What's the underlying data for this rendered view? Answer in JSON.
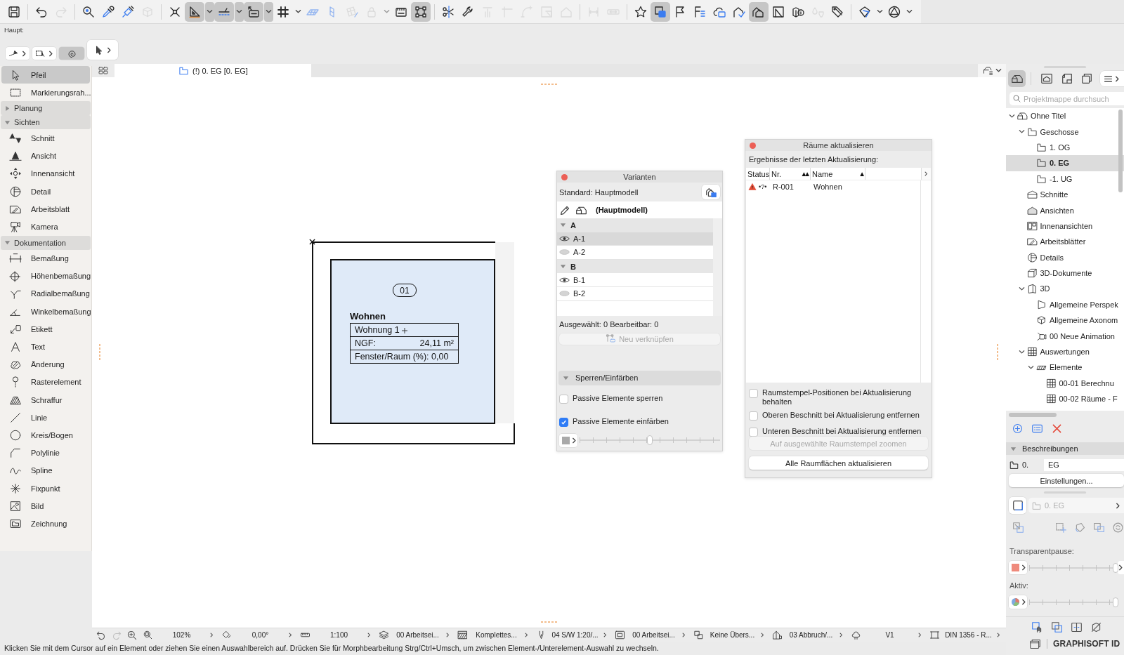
{
  "toolbar": {
    "groups": [
      {
        "buttons": [
          {
            "kind": "save",
            "pressed": false,
            "disabled": false,
            "has_menu": false
          }
        ]
      },
      {
        "buttons": [
          {
            "kind": "undo",
            "pressed": false,
            "disabled": false,
            "has_menu": false
          },
          {
            "kind": "redo",
            "pressed": false,
            "disabled": true,
            "has_menu": false
          }
        ]
      },
      {
        "buttons": [
          {
            "kind": "find",
            "pressed": false,
            "disabled": false,
            "has_menu": false
          },
          {
            "kind": "eyedropper",
            "pressed": false,
            "disabled": false,
            "has_menu": false
          },
          {
            "kind": "syringe",
            "pressed": false,
            "disabled": false,
            "has_menu": false
          },
          {
            "kind": "cube",
            "pressed": false,
            "disabled": true,
            "has_menu": false
          }
        ]
      },
      {
        "buttons": [
          {
            "kind": "crosspoint",
            "pressed": false,
            "disabled": false,
            "has_menu": false
          },
          {
            "kind": "set_square",
            "pressed": true,
            "disabled": false,
            "has_menu": true
          },
          {
            "kind": "guide_lines",
            "pressed": true,
            "disabled": false,
            "has_menu": true
          },
          {
            "kind": "coordinates",
            "pressed": true,
            "disabled": false,
            "has_menu": true
          },
          {
            "kind": "grid",
            "pressed": false,
            "disabled": false,
            "has_menu": true
          },
          {
            "kind": "slanted_plane",
            "pressed": false,
            "disabled": true,
            "has_menu": false
          },
          {
            "kind": "vertical_plane",
            "pressed": false,
            "disabled": true,
            "has_menu": false
          },
          {
            "kind": "grid_sheet",
            "pressed": false,
            "disabled": true,
            "has_menu": false
          },
          {
            "kind": "padlock",
            "pressed": false,
            "disabled": true,
            "has_menu": true
          },
          {
            "kind": "ruler_box",
            "pressed": false,
            "disabled": false,
            "has_menu": false
          },
          {
            "kind": "frame_handles",
            "pressed": true,
            "disabled": false,
            "has_menu": false
          }
        ]
      },
      {
        "buttons": [
          {
            "kind": "scissors",
            "pressed": false,
            "disabled": false,
            "has_menu": false
          },
          {
            "kind": "wrench",
            "pressed": false,
            "disabled": false,
            "has_menu": false
          },
          {
            "kind": "top_line",
            "pressed": false,
            "disabled": true,
            "has_menu": false
          },
          {
            "kind": "corner",
            "pressed": false,
            "disabled": true,
            "has_menu": false
          },
          {
            "kind": "curve",
            "pressed": false,
            "disabled": true,
            "has_menu": false
          },
          {
            "kind": "nested_squares",
            "pressed": false,
            "disabled": true,
            "has_menu": false
          },
          {
            "kind": "house_outline",
            "pressed": false,
            "disabled": true,
            "has_menu": false
          }
        ]
      },
      {
        "buttons": [
          {
            "kind": "bracket_span",
            "pressed": false,
            "disabled": true,
            "has_menu": false
          },
          {
            "kind": "bar_arrows",
            "pressed": false,
            "disabled": true,
            "has_menu": false
          }
        ]
      },
      {
        "buttons": [
          {
            "kind": "star",
            "pressed": false,
            "disabled": false,
            "has_menu": false
          },
          {
            "kind": "stacked_windows",
            "pressed": true,
            "disabled": false,
            "has_menu": false
          },
          {
            "kind": "flag",
            "pressed": false,
            "disabled": false,
            "has_menu": false
          },
          {
            "kind": "list_lines",
            "pressed": false,
            "disabled": false,
            "has_menu": false
          },
          {
            "kind": "cloud",
            "pressed": false,
            "disabled": false,
            "has_menu": false
          },
          {
            "kind": "house_check",
            "pressed": false,
            "disabled": false,
            "has_menu": false
          },
          {
            "kind": "houses",
            "pressed": true,
            "disabled": false,
            "has_menu": false
          },
          {
            "kind": "framed_triangle",
            "pressed": false,
            "disabled": false,
            "has_menu": false
          },
          {
            "kind": "cube_info",
            "pressed": false,
            "disabled": false,
            "has_menu": false
          },
          {
            "kind": "droplet",
            "pressed": false,
            "disabled": true,
            "has_menu": false
          },
          {
            "kind": "tag",
            "pressed": false,
            "disabled": false,
            "has_menu": false
          }
        ]
      },
      {
        "buttons": [
          {
            "kind": "tilted_square",
            "pressed": false,
            "disabled": false,
            "has_menu": true
          },
          {
            "kind": "circle_triangle",
            "pressed": false,
            "disabled": false,
            "has_menu": true
          }
        ]
      }
    ]
  },
  "secondary_toolbar": {
    "label": "Haupt:",
    "buttons": [
      {
        "kind": "wall_select",
        "pressed": false,
        "has_menu": true
      },
      {
        "kind": "marquee_select",
        "pressed": false,
        "has_menu": true
      },
      {
        "kind": "magnet",
        "pressed": true,
        "has_menu": false
      },
      {
        "kind": "pointer",
        "pressed": false,
        "has_menu": true
      }
    ]
  },
  "toolbox": {
    "tools": [
      {
        "kind": "arrow",
        "label": "Pfeil",
        "selected": true
      },
      {
        "kind": "marquee",
        "label": "Markierungsrah...",
        "selected": false
      }
    ],
    "groups": [
      {
        "label": "Planung",
        "expanded": false
      },
      {
        "label": "Sichten",
        "expanded": true,
        "tools": [
          {
            "kind": "section",
            "label": "Schnitt",
            "selected": false
          },
          {
            "kind": "elevation",
            "label": "Ansicht",
            "selected": false
          },
          {
            "kind": "interior",
            "label": "Innenansicht",
            "selected": false
          },
          {
            "kind": "detail",
            "label": "Detail",
            "selected": false
          },
          {
            "kind": "worksheet",
            "label": "Arbeitsblatt",
            "selected": false
          },
          {
            "kind": "camera",
            "label": "Kamera",
            "selected": false
          }
        ]
      },
      {
        "label": "Dokumentation",
        "expanded": true,
        "tools": [
          {
            "kind": "dimension",
            "label": "Bemaßung",
            "selected": false
          },
          {
            "kind": "level_dimension",
            "label": "Höhenbemaßung",
            "selected": false
          },
          {
            "kind": "radial_dimension",
            "label": "Radialbemaßung",
            "selected": false
          },
          {
            "kind": "angle_dimension",
            "label": "Winkelbemaßung",
            "selected": false
          },
          {
            "kind": "label",
            "label": "Etikett",
            "selected": false
          },
          {
            "kind": "text",
            "label": "Text",
            "selected": false
          },
          {
            "kind": "change",
            "label": "Änderung",
            "selected": false
          },
          {
            "kind": "grid_element",
            "label": "Rasterelement",
            "selected": false
          },
          {
            "kind": "fill",
            "label": "Schraffur",
            "selected": false
          },
          {
            "kind": "line",
            "label": "Linie",
            "selected": false
          },
          {
            "kind": "arc",
            "label": "Kreis/Bogen",
            "selected": false
          },
          {
            "kind": "polyline",
            "label": "Polylinie",
            "selected": false
          },
          {
            "kind": "spline",
            "label": "Spline",
            "selected": false
          },
          {
            "kind": "hotspot",
            "label": "Fixpunkt",
            "selected": false
          },
          {
            "kind": "figure",
            "label": "Bild",
            "selected": false
          },
          {
            "kind": "drawing",
            "label": "Zeichnung",
            "selected": false
          }
        ]
      }
    ]
  },
  "tab_bar": {
    "tabs": [
      {
        "label": "(!) 0. EG [0. EG]",
        "selected": true
      }
    ]
  },
  "plan": {
    "zone": {
      "number": "01",
      "name": "Wohnen",
      "rows": [
        {
          "label": "Wohnung 1"
        },
        {
          "label": "NGF:",
          "value": "24,11 m²"
        },
        {
          "label": "Fenster/Raum (%): 0,00"
        }
      ]
    }
  },
  "variants_panel": {
    "title": "Varianten",
    "standard": "Standard: Hauptmodell",
    "main_model": "(Hauptmodell)",
    "groups": [
      {
        "label": "A",
        "expanded": true,
        "variants": [
          {
            "label": "A-1",
            "visible": true,
            "selected": true
          },
          {
            "label": "A-2",
            "visible": false,
            "selected": false
          }
        ]
      },
      {
        "label": "B",
        "expanded": true,
        "variants": [
          {
            "label": "B-1",
            "visible": true,
            "selected": false
          },
          {
            "label": "B-2",
            "visible": false,
            "selected": false
          }
        ]
      }
    ],
    "summary": "Ausgewählt: 0 Bearbeitbar: 0",
    "relink_button": {
      "label": "Neu verknüpfen",
      "disabled": true
    },
    "section": {
      "label": "Sperren/Einfärben",
      "expanded": true
    },
    "options": [
      {
        "label": "Passive Elemente sperren",
        "checked": false
      },
      {
        "label": "Passive Elemente einfärben",
        "checked": true
      }
    ],
    "slider": {
      "level": 0.5
    }
  },
  "rooms_panel": {
    "title": "Räume aktualisieren",
    "subtitle": "Ergebnisse der letzten Aktualisierung:",
    "columns": [
      {
        "label": "Status"
      },
      {
        "label": "Nr.",
        "sort_indicator": "▲▲"
      },
      {
        "label": "Name",
        "sort_indicator": "▲"
      }
    ],
    "rows": [
      {
        "warning": true,
        "symbol": "•?•",
        "number": "R-001",
        "name": "Wohnen"
      }
    ],
    "options": [
      {
        "label": "Raumstempel-Positionen bei Aktualisierung behalten",
        "checked": false
      },
      {
        "label": "Oberen Beschnitt bei Aktualisierung entfernen",
        "checked": false
      },
      {
        "label": "Unteren Beschnitt bei Aktualisierung entfernen",
        "checked": false
      }
    ],
    "buttons": [
      {
        "label": "Auf ausgewählte Raumstempel zoomen",
        "disabled": true
      },
      {
        "label": "Alle Raumflächen aktualisieren",
        "disabled": false
      }
    ]
  },
  "navigator": {
    "tabs": [
      {
        "kind": "project_map",
        "selected": true
      },
      {
        "kind": "view_map",
        "selected": false
      },
      {
        "kind": "layout_book",
        "selected": false
      },
      {
        "kind": "publisher",
        "selected": false
      }
    ],
    "search": {
      "placeholder": "Projektmappe durchsuch"
    },
    "tree": [
      {
        "kind": "project",
        "label": "Ohne Titel",
        "expanded": true,
        "selected": false,
        "children": [
          {
            "kind": "storeys",
            "label": "Geschosse",
            "expanded": true,
            "selected": false,
            "children": [
              {
                "kind": "storey",
                "label": "1. OG",
                "selected": false
              },
              {
                "kind": "storey",
                "label": "0. EG",
                "selected": true
              },
              {
                "kind": "storey",
                "label": "-1. UG",
                "selected": false
              }
            ]
          },
          {
            "kind": "sections",
            "label": "Schnitte",
            "selected": false
          },
          {
            "kind": "elevations",
            "label": "Ansichten",
            "selected": false
          },
          {
            "kind": "interiors",
            "label": "Innenansichten",
            "selected": false
          },
          {
            "kind": "worksheets",
            "label": "Arbeitsblätter",
            "selected": false
          },
          {
            "kind": "details",
            "label": "Details",
            "selected": false
          },
          {
            "kind": "documents3d",
            "label": "3D-Dokumente",
            "selected": false
          },
          {
            "kind": "model3d",
            "label": "3D",
            "expanded": true,
            "selected": false,
            "children": [
              {
                "kind": "perspective",
                "label": "Allgemeine Perspek",
                "selected": false
              },
              {
                "kind": "axonometry",
                "label": "Allgemeine Axonom",
                "selected": false
              },
              {
                "kind": "animation",
                "label": "00 Neue Animation",
                "selected": false
              }
            ]
          },
          {
            "kind": "schedules",
            "label": "Auswertungen",
            "expanded": true,
            "selected": false,
            "children": [
              {
                "kind": "schedule_folder",
                "label": "Elemente",
                "expanded": true,
                "selected": false,
                "children": [
                  {
                    "kind": "schedule",
                    "label": "00-01 Berechnu",
                    "selected": false
                  },
                  {
                    "kind": "schedule",
                    "label": "00-02 Räume - F",
                    "selected": false
                  }
                ]
              }
            ]
          }
        ]
      }
    ],
    "description": {
      "title": "Beschreibungen",
      "expanded": true,
      "prefix": "0.",
      "value": "EG",
      "settings_button": "Einstellungen..."
    },
    "layout_dropdown": {
      "value": "0. EG",
      "disabled": true
    },
    "transparency": {
      "label": "Transparentpause:",
      "level": 1
    },
    "active": {
      "label": "Aktiv:",
      "level": 1
    },
    "account": {
      "label": "GRAPHISOFT ID"
    }
  },
  "navigation_bar": {
    "view_buttons": [
      {
        "kind": "previous_view",
        "disabled": false
      },
      {
        "kind": "next_view",
        "disabled": true
      },
      {
        "kind": "zoom_in",
        "disabled": false
      }
    ],
    "items": [
      {
        "kind": "zoom",
        "value": "102%"
      },
      {
        "kind": "rotation",
        "value": "0,00°"
      },
      {
        "kind": "scale",
        "value": "1:100"
      },
      {
        "kind": "layers",
        "value": "00 Arbeitsei..."
      },
      {
        "kind": "structure",
        "value": "Komplettes..."
      },
      {
        "kind": "pen_set",
        "value": "04 S/W 1:20/..."
      },
      {
        "kind": "model_view",
        "value": "00 Arbeitsei..."
      },
      {
        "kind": "overrides",
        "value": "Keine Übers..."
      },
      {
        "kind": "renovation",
        "value": "03 Abbruch/..."
      },
      {
        "kind": "revision",
        "value": "V1"
      },
      {
        "kind": "dimension_standard",
        "value": "DIN 1356 - R..."
      }
    ]
  },
  "status_text": "Klicken Sie mit dem Cursor auf ein Element oder ziehen Sie einen Auswahlbereich auf. Drücken Sie für Morphbearbeitung Strg/Ctrl+Umsch, um zwischen Element-/Unterelement-Auswahl zu wechseln."
}
